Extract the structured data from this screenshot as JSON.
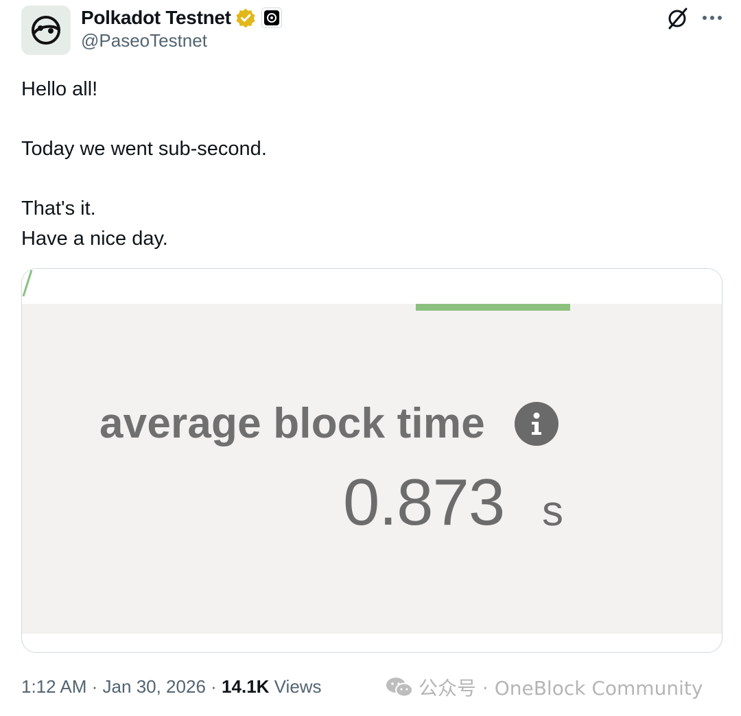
{
  "author": {
    "display_name": "Polkadot Testnet",
    "handle": "@PaseoTestnet",
    "avatar_icon": "paseo-logo-icon",
    "verified_badge_icon": "gold-verified-badge-icon",
    "affiliate_icon": "polkadot-affiliate-icon"
  },
  "header_actions": {
    "grok_icon": "grok-icon",
    "more_icon": "more-dots-icon"
  },
  "tweet": {
    "lines": [
      "Hello all!",
      "Today we went sub-second.",
      "That's it.",
      "Have a nice day."
    ]
  },
  "media": {
    "metric_label": "average block time",
    "metric_value": "0.873",
    "metric_unit": "s",
    "info_icon": "info-icon",
    "accent_color": "#8cc07f"
  },
  "footer": {
    "time": "1:12 AM",
    "separator": "·",
    "date": "Jan 30, 2026",
    "views_count": "14.1K",
    "views_label": "Views"
  },
  "watermark": {
    "text": "公众号 · OneBlock Community",
    "icon": "wechat-icon"
  },
  "colors": {
    "text_primary": "#0f1419",
    "text_secondary": "#536471",
    "verified_gold": "#e2b719"
  }
}
